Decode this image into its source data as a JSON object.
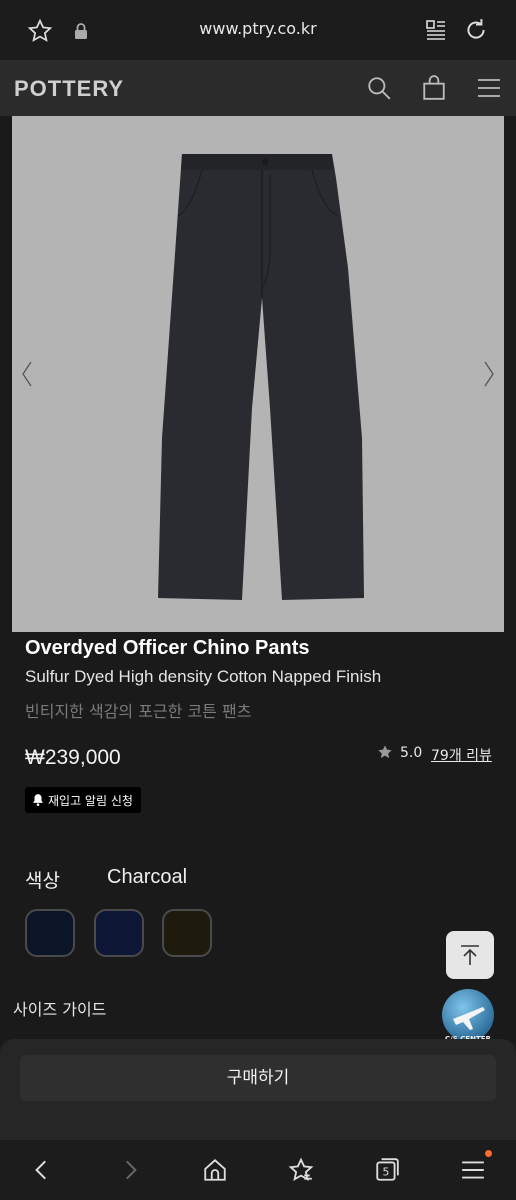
{
  "browser": {
    "url": "www.ptry.co.kr",
    "icons": [
      "star-outline",
      "lock",
      "reader-mode",
      "reload"
    ]
  },
  "header": {
    "logo": "POTTERY",
    "icons": [
      "search",
      "shopping-bag",
      "hamburger-menu"
    ]
  },
  "product": {
    "image_arrows": [
      "chevron-left",
      "chevron-right"
    ],
    "name": "Overdyed Officer Chino Pants",
    "subtitle": "Sulfur Dyed High density Cotton Napped Finish",
    "description_kr": "빈티지한 색감의 포근한 코튼 팬츠",
    "price": "₩239,000",
    "rating": "5.0",
    "reviews_label": "79개 리뷰",
    "restock_label": "재입고 알림 신청"
  },
  "color": {
    "label": "색상",
    "selected": "Charcoal",
    "swatches": [
      "#0b1527",
      "#0e1636",
      "#1f1a0e"
    ]
  },
  "size_guide": "사이즈 가이드",
  "cs_badge": "C/S CENTER",
  "buy_label": "구매하기",
  "bottom_nav": {
    "tabs_count": "5",
    "icons": [
      "back",
      "forward",
      "home",
      "bookmarks",
      "tabs",
      "menu"
    ]
  },
  "colors": {
    "background": "#1a1a1a",
    "header": "#2b2b2b",
    "image_bg": "#b4b4b4",
    "notification_dot": "#ff6d2d"
  }
}
